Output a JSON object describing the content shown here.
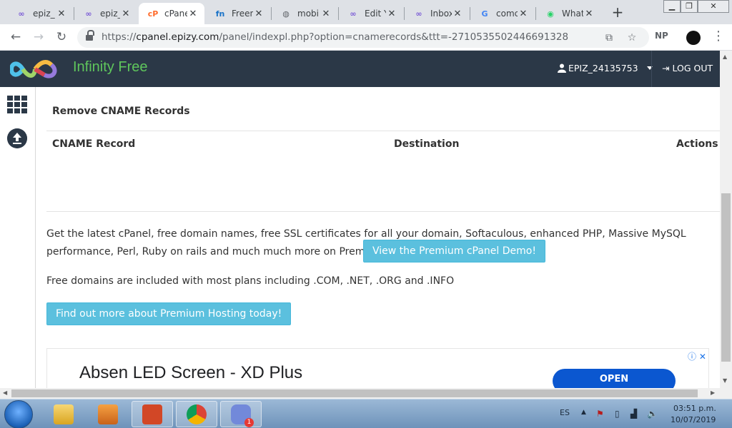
{
  "browser": {
    "tabs": [
      {
        "title": "epiz_",
        "favicon": "infinity-icon",
        "color": "#7b5bd6"
      },
      {
        "title": "epiz_",
        "favicon": "infinity-icon",
        "color": "#7b5bd6"
      },
      {
        "title": "cPane",
        "favicon": "cpanel-icon",
        "color": "#ff6c2c",
        "active": true
      },
      {
        "title": "Freen",
        "favicon": "freenom-icon",
        "color": "#1a73c8"
      },
      {
        "title": "mobi",
        "favicon": "globe-icon",
        "color": "#5f6368"
      },
      {
        "title": "Edit Y",
        "favicon": "infinity-icon",
        "color": "#7b5bd6"
      },
      {
        "title": "Inbox",
        "favicon": "infinity-icon",
        "color": "#7b5bd6"
      },
      {
        "title": "comc",
        "favicon": "google-icon",
        "color": "#4285f4"
      },
      {
        "title": "What",
        "favicon": "whatsapp-icon",
        "color": "#25d366"
      }
    ],
    "url_host": "cpanel.epizy.com",
    "url_path": "/panel/indexpl.php?option=cnamerecords&ttt=-2710535502446691328",
    "url_scheme": "https://",
    "extension_label": "NP"
  },
  "header": {
    "brand": "Infinity Free",
    "username": "EPIZ_24135753",
    "logout_label": "LOG OUT"
  },
  "panel": {
    "title": "Remove CNAME Records",
    "columns": [
      "CNAME Record",
      "Destination",
      "Actions"
    ]
  },
  "promo": {
    "text": "Get the latest cPanel, free domain names, free SSL certificates for all your domain, Softaculous, enhanced PHP, Massive MySQL performance, Perl, Ruby on rails and much much more on Premium hosting now !",
    "demo_button": "View the Premium cPanel Demo!",
    "free_domains": "Free domains are included with most plans including .COM, .NET, .ORG and .INFO",
    "findout_button": "Find out more about Premium Hosting today!"
  },
  "ad": {
    "title": "Absen LED Screen - XD Plus",
    "cta": "OPEN"
  },
  "taskbar": {
    "language": "ES",
    "time": "03:51 p.m.",
    "date": "10/07/2019",
    "discord_badge": "1"
  }
}
